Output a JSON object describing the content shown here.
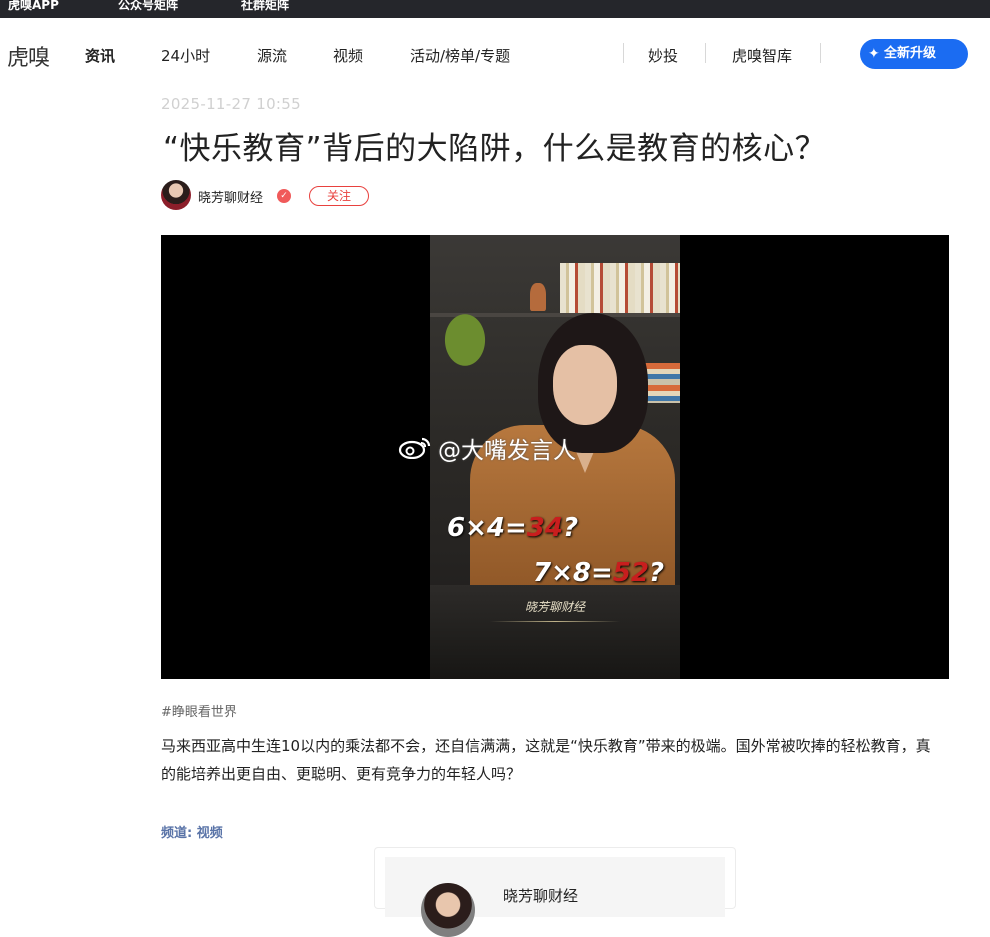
{
  "topbar": {
    "items": [
      "虎嗅APP",
      "公众号矩阵",
      "社群矩阵"
    ]
  },
  "nav": {
    "logo": "虎嗅",
    "items": [
      "资讯",
      "24小时",
      "源流",
      "视频",
      "活动/榜单/专题",
      "妙投",
      "虎嗅智库"
    ],
    "active": "资讯",
    "upgrade_label": "全新升级"
  },
  "article": {
    "date": "2025-11-27 10:55",
    "title": "“快乐教育”背后的大陷阱，什么是教育的核心？",
    "author": "晓芳聊财经",
    "follow_label": "关注",
    "hashtag": "#睁眼看世界",
    "description": "马来西亚高中生连10以内的乘法都不会，还自信满满，这就是“快乐教育”带来的极端。国外常被吹捧的轻松教育，真的能培养出更自由、更聪明、更有竞争力的年轻人吗？",
    "channel": "频道: 视频"
  },
  "video": {
    "watermark": "@大嘴发言人",
    "eq1_prefix": "6×4=",
    "eq1_answer": "34",
    "eq1_suffix": "?",
    "eq2_prefix": "7×8=",
    "eq2_answer": "52",
    "eq2_suffix": "?",
    "brand_mark": "晓芳聊财经"
  },
  "author_card": {
    "name": "晓芳聊财经"
  },
  "colors": {
    "accent_blue": "#1b6cf2",
    "follow_red": "#e8413e",
    "channel_blue": "#5a74a8"
  }
}
